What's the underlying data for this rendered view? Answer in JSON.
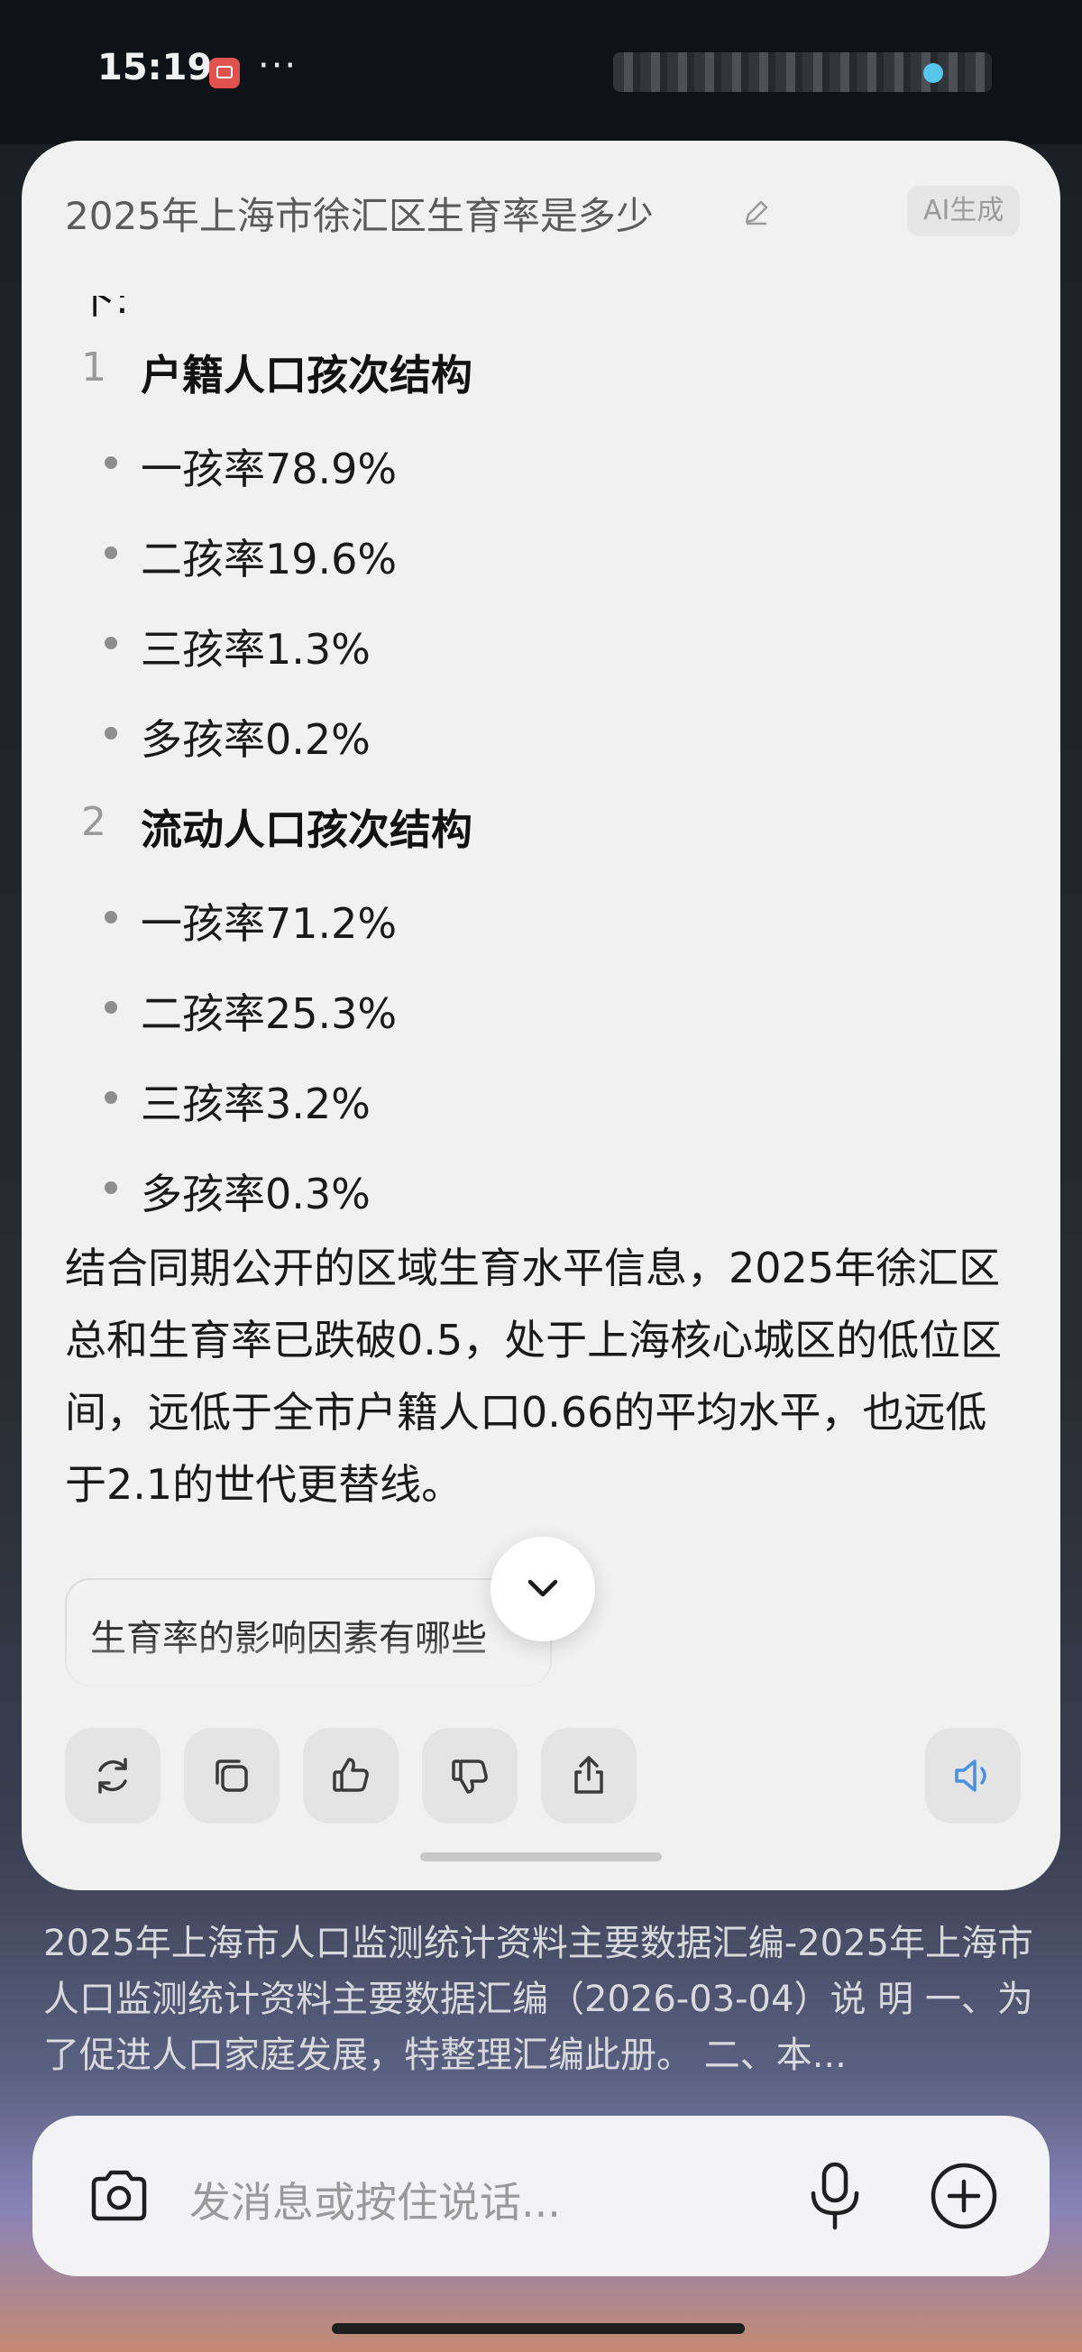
{
  "status_bar": {
    "time": "15:19",
    "dots": "···"
  },
  "card": {
    "title": "2025年上海市徐汇区生育率是多少",
    "ai_badge": "AI生成",
    "cut_text": "下:",
    "sections": [
      {
        "number": "1",
        "title": "户籍人口孩次结构",
        "items": [
          "一孩率78.9%",
          "二孩率19.6%",
          "三孩率1.3%",
          "多孩率0.2%"
        ]
      },
      {
        "number": "2",
        "title": "流动人口孩次结构",
        "items": [
          "一孩率71.2%",
          "二孩率25.3%",
          "三孩率3.2%",
          "多孩率0.3%"
        ]
      }
    ],
    "paragraph": "结合同期公开的区域生育水平信息，2025年徐汇区总和生育率已跌破0.5，处于上海核心城区的低位区间，远低于全市户籍人口0.66的平均水平，也远低于2.1的世代更替线。",
    "suggestion": "生育率的影响因素有哪些",
    "actions": [
      "refresh-icon",
      "copy-icon",
      "thumbs-up-icon",
      "thumbs-down-icon",
      "share-icon",
      "speaker-icon"
    ],
    "accent_color": "#4a90e2"
  },
  "background_text": "2025年上海市人口监测统计资料主要数据汇编-2025年上海市人口监测统计资料主要数据汇编（2026-03-04）说 明 一、为了促进人口家庭发展，特整理汇编此册。 二、本...",
  "input": {
    "placeholder": "发消息或按住说话..."
  }
}
